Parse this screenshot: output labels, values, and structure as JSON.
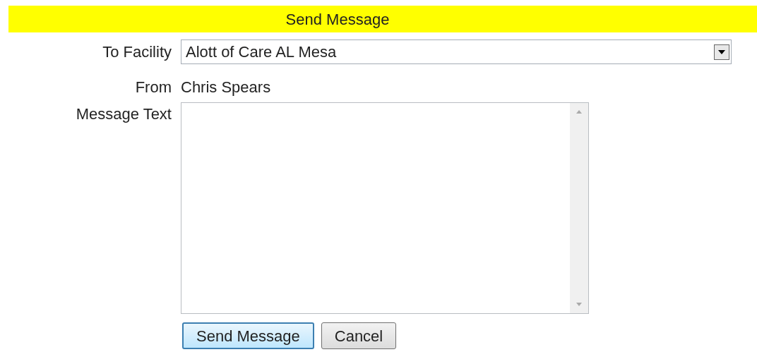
{
  "title": "Send Message",
  "to_facility": {
    "label": "To Facility",
    "value": "Alott of Care AL Mesa"
  },
  "from": {
    "label": "From",
    "value": "Chris Spears"
  },
  "message_text": {
    "label": "Message Text"
  },
  "buttons": [
    {
      "label": "Send Message",
      "focused": true
    },
    {
      "label": "Cancel",
      "focused": false
    }
  ]
}
